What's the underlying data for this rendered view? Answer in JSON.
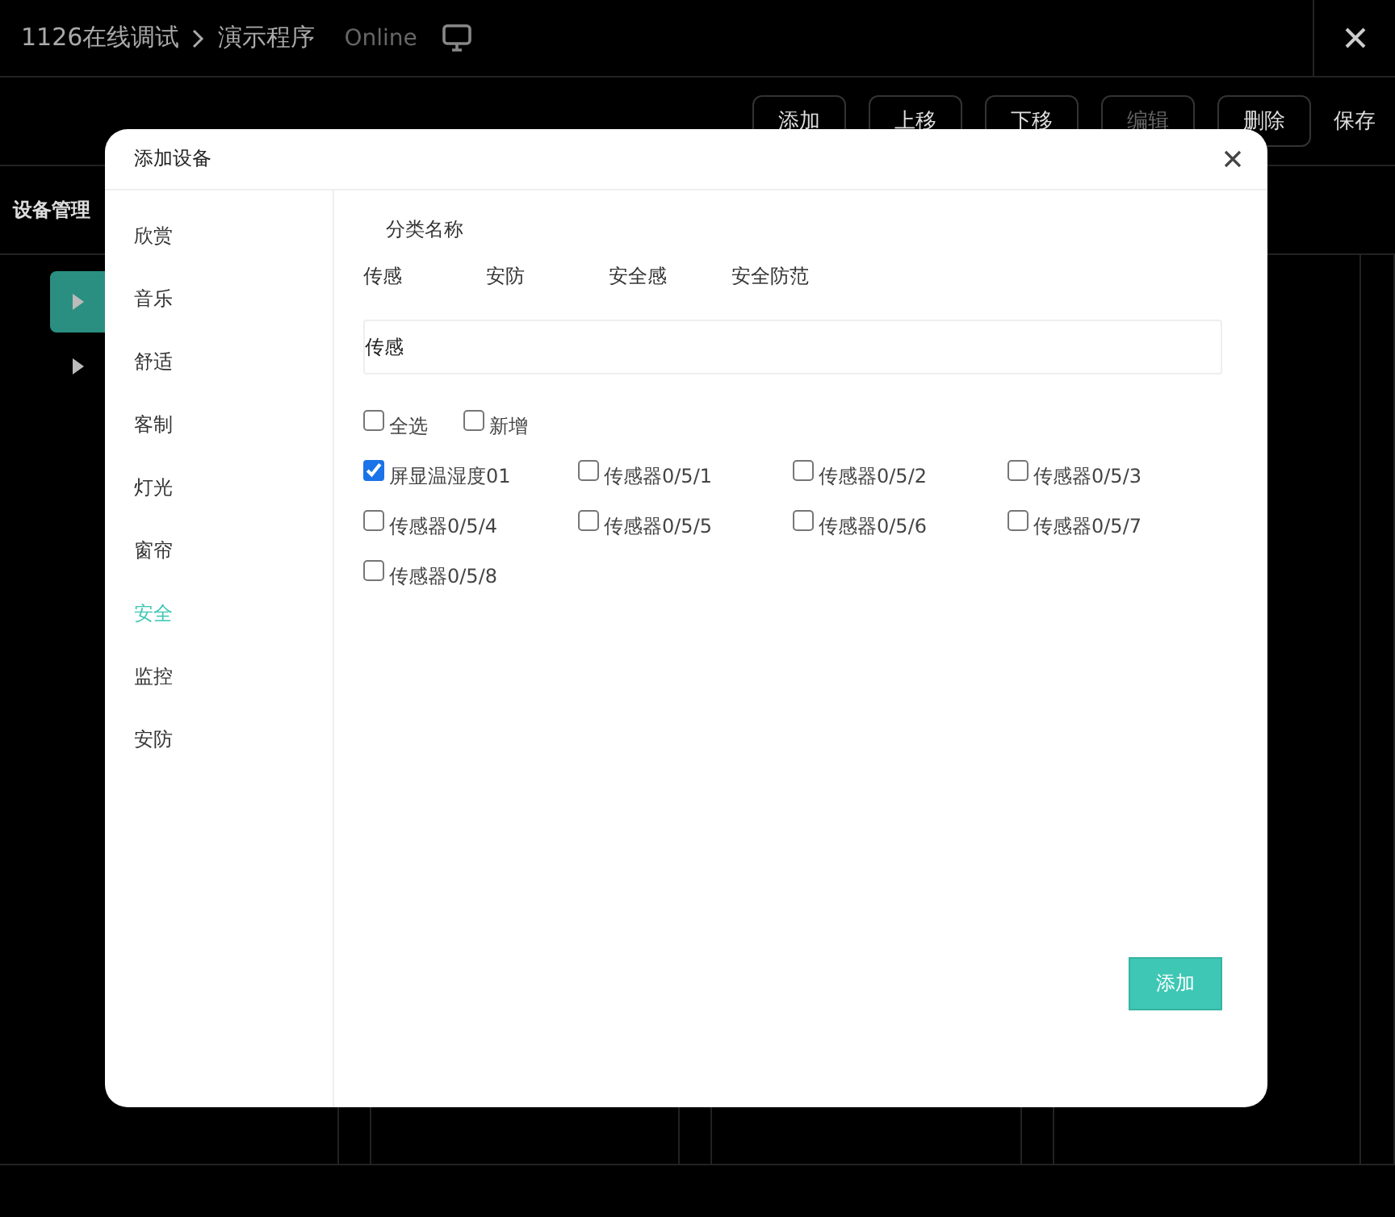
{
  "header": {
    "breadcrumb": "1126在线调试",
    "page": "演示程序",
    "status": "Online"
  },
  "toolbar": [
    {
      "label": "添加",
      "disabled": false
    },
    {
      "label": "上移",
      "disabled": false
    },
    {
      "label": "下移",
      "disabled": false
    },
    {
      "label": "编辑",
      "disabled": true
    },
    {
      "label": "删除",
      "disabled": false
    }
  ],
  "save": "保存",
  "panel_title": "设备管理",
  "tree": [
    {
      "selected": true
    },
    {
      "selected": false
    }
  ],
  "dialog": {
    "title": "添加设备",
    "categories": [
      {
        "label": "欣赏",
        "selected": false
      },
      {
        "label": "音乐",
        "selected": false
      },
      {
        "label": "舒适",
        "selected": false
      },
      {
        "label": "客制",
        "selected": false
      },
      {
        "label": "灯光",
        "selected": false
      },
      {
        "label": "窗帘",
        "selected": false
      },
      {
        "label": "安全",
        "selected": true
      },
      {
        "label": "监控",
        "selected": false
      },
      {
        "label": "安防",
        "selected": false
      }
    ],
    "group_label": "分类名称",
    "groups": [
      "传感",
      "安防",
      "安全感",
      "安全防范"
    ],
    "name_value": "传感",
    "options": [
      {
        "label": "全选",
        "checked": false
      },
      {
        "label": "新增",
        "checked": false
      }
    ],
    "devices": [
      {
        "label": "屏显温湿度01",
        "checked": true
      },
      {
        "label": "传感器0/5/1",
        "checked": false
      },
      {
        "label": "传感器0/5/2",
        "checked": false
      },
      {
        "label": "传感器0/5/3",
        "checked": false
      },
      {
        "label": "传感器0/5/4",
        "checked": false
      },
      {
        "label": "传感器0/5/5",
        "checked": false
      },
      {
        "label": "传感器0/5/6",
        "checked": false
      },
      {
        "label": "传感器0/5/7",
        "checked": false
      },
      {
        "label": "传感器0/5/8",
        "checked": false
      }
    ],
    "add_button": "添加"
  }
}
